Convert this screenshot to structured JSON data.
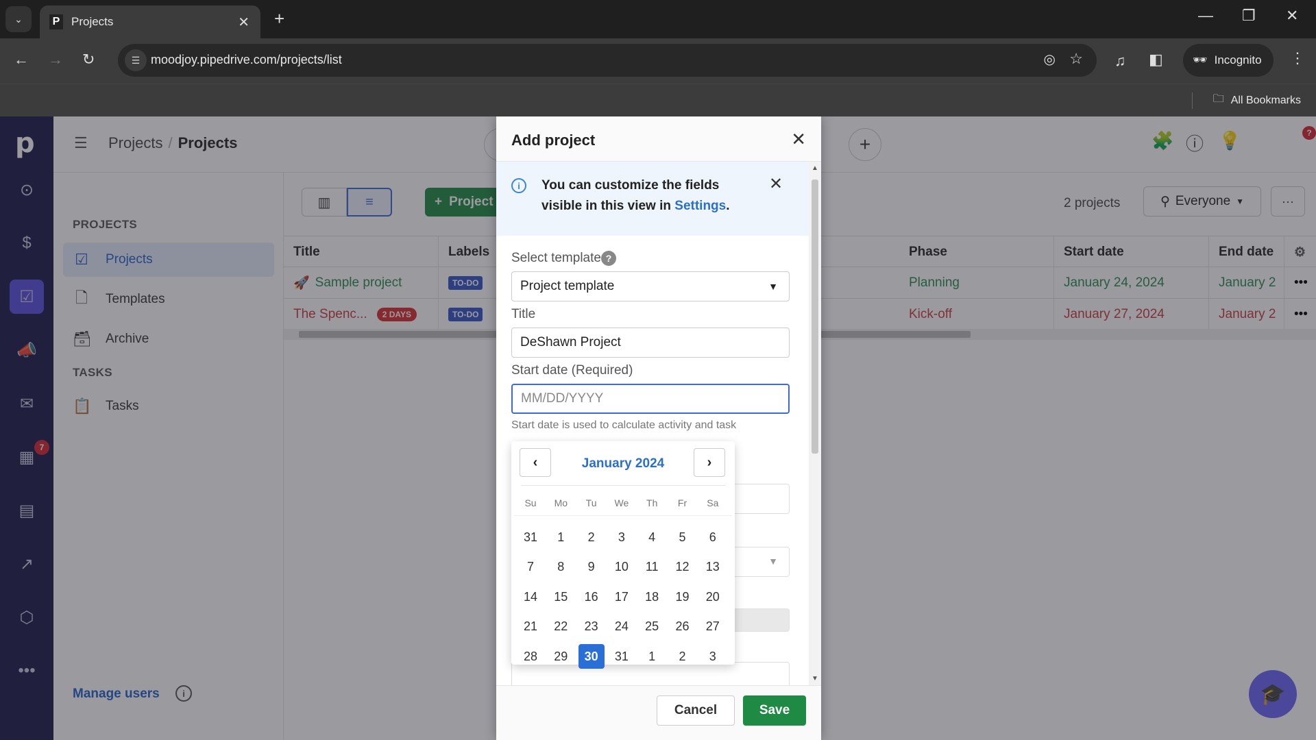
{
  "browser": {
    "tab_title": "Projects",
    "tab_favicon": "P",
    "url": "moodjoy.pipedrive.com/projects/list",
    "profile_label": "Incognito",
    "bookmarks_label": "All Bookmarks"
  },
  "rail": {
    "logo": "p",
    "items": [
      {
        "icon": "target-icon"
      },
      {
        "icon": "dollar-icon"
      },
      {
        "icon": "projects-icon",
        "active": true
      },
      {
        "icon": "megaphone-icon"
      },
      {
        "icon": "mail-icon"
      },
      {
        "icon": "calendar-icon",
        "badge": "7"
      },
      {
        "icon": "contacts-icon"
      },
      {
        "icon": "insights-icon"
      },
      {
        "icon": "products-icon"
      },
      {
        "icon": "more-icon"
      }
    ]
  },
  "header": {
    "breadcrumb_parent": "Projects",
    "breadcrumb_sep": "/",
    "breadcrumb_current": "Projects",
    "bulb_badge": "?"
  },
  "subnav": {
    "projects_heading": "PROJECTS",
    "items": [
      {
        "label": "Projects",
        "active": true
      },
      {
        "label": "Templates"
      },
      {
        "label": "Archive"
      }
    ],
    "tasks_heading": "TASKS",
    "tasks_items": [
      {
        "label": "Tasks"
      }
    ],
    "manage_users": "Manage users"
  },
  "toolbar": {
    "add_project_label": "Project",
    "count": "2 projects",
    "filter_label": "Everyone",
    "more_label": "···"
  },
  "grid": {
    "columns": [
      "Title",
      "Labels",
      "Phase",
      "Start date",
      "End date"
    ],
    "rows": [
      {
        "title": "Sample project",
        "label": "TO-DO",
        "phase": "Planning",
        "start": "January 24, 2024",
        "end": "January 2",
        "status": "ok"
      },
      {
        "title": "The Spenc...",
        "badge": "2 DAYS",
        "label": "TO-DO",
        "phase": "Kick-off",
        "start": "January 27, 2024",
        "end": "January 2",
        "status": "overdue"
      }
    ]
  },
  "modal": {
    "title": "Add project",
    "info_text": "You can customize the fields visible in this view in ",
    "info_link": "Settings",
    "info_end": ".",
    "template_label": "Select template",
    "template_value": "Project template",
    "title_label": "Title",
    "title_value": "DeShawn Project",
    "start_label": "Start date (Required)",
    "start_placeholder": "MM/DD/YYYY",
    "start_hint": "Start date is used to calculate activity and task",
    "cancel_label": "Cancel",
    "save_label": "Save"
  },
  "calendar": {
    "month_label": "January 2024",
    "prev_label": "‹",
    "next_label": "›",
    "weekdays": [
      "Su",
      "Mo",
      "Tu",
      "We",
      "Th",
      "Fr",
      "Sa"
    ],
    "weeks": [
      [
        "31",
        "1",
        "2",
        "3",
        "4",
        "5",
        "6"
      ],
      [
        "7",
        "8",
        "9",
        "10",
        "11",
        "12",
        "13"
      ],
      [
        "14",
        "15",
        "16",
        "17",
        "18",
        "19",
        "20"
      ],
      [
        "21",
        "22",
        "23",
        "24",
        "25",
        "26",
        "27"
      ],
      [
        "28",
        "29",
        "30",
        "31",
        "1",
        "2",
        "3"
      ]
    ],
    "selected": "30"
  },
  "colors": {
    "brand_green": "#1f8a43",
    "rail_bg": "#1a1a48",
    "accent_blue": "#2a6fd6",
    "overdue_red": "#cf3a3a"
  }
}
